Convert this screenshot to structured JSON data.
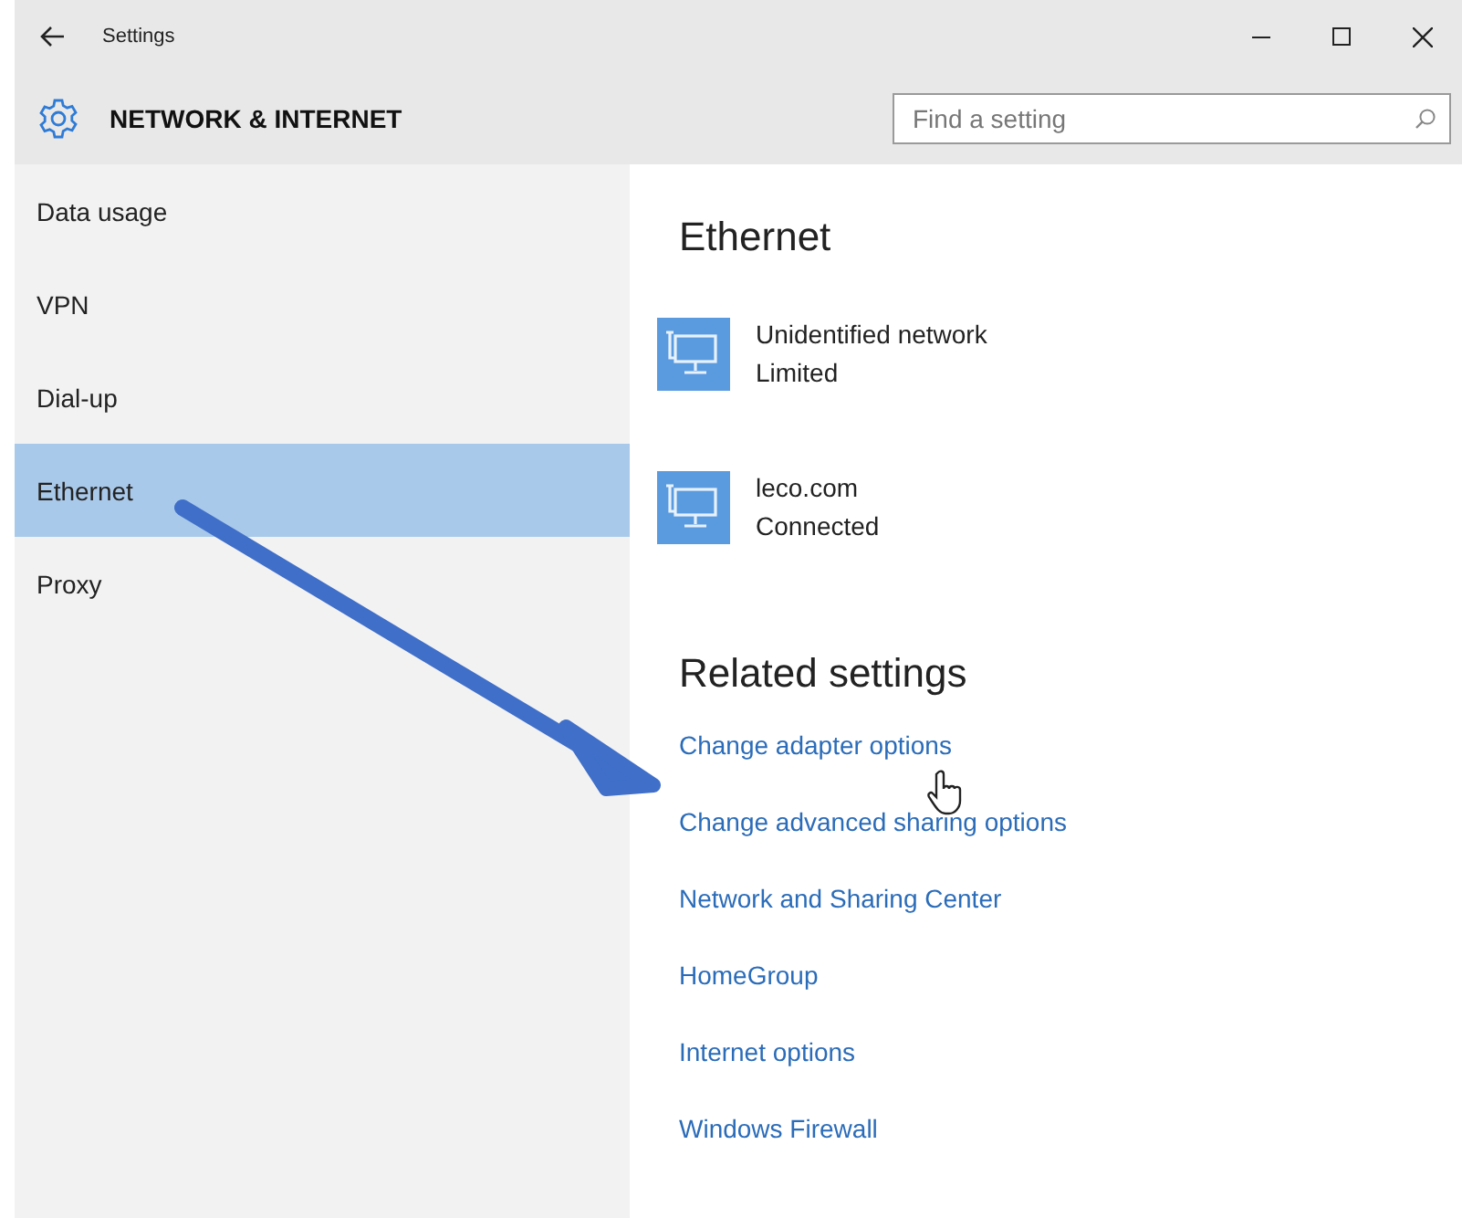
{
  "window": {
    "title": "Settings"
  },
  "header": {
    "title": "NETWORK & INTERNET"
  },
  "search": {
    "placeholder": "Find a setting"
  },
  "sidebar": {
    "items": [
      {
        "label": "Data usage",
        "selected": false
      },
      {
        "label": "VPN",
        "selected": false
      },
      {
        "label": "Dial-up",
        "selected": false
      },
      {
        "label": "Ethernet",
        "selected": true
      },
      {
        "label": "Proxy",
        "selected": false
      }
    ]
  },
  "content": {
    "heading": "Ethernet",
    "networks": [
      {
        "name": "Unidentified network",
        "status": "Limited"
      },
      {
        "name": "leco.com",
        "status": "Connected"
      }
    ],
    "related": {
      "heading": "Related settings",
      "links": [
        "Change adapter options",
        "Change advanced sharing options",
        "Network and Sharing Center",
        "HomeGroup",
        "Internet options",
        "Windows Firewall"
      ]
    }
  }
}
